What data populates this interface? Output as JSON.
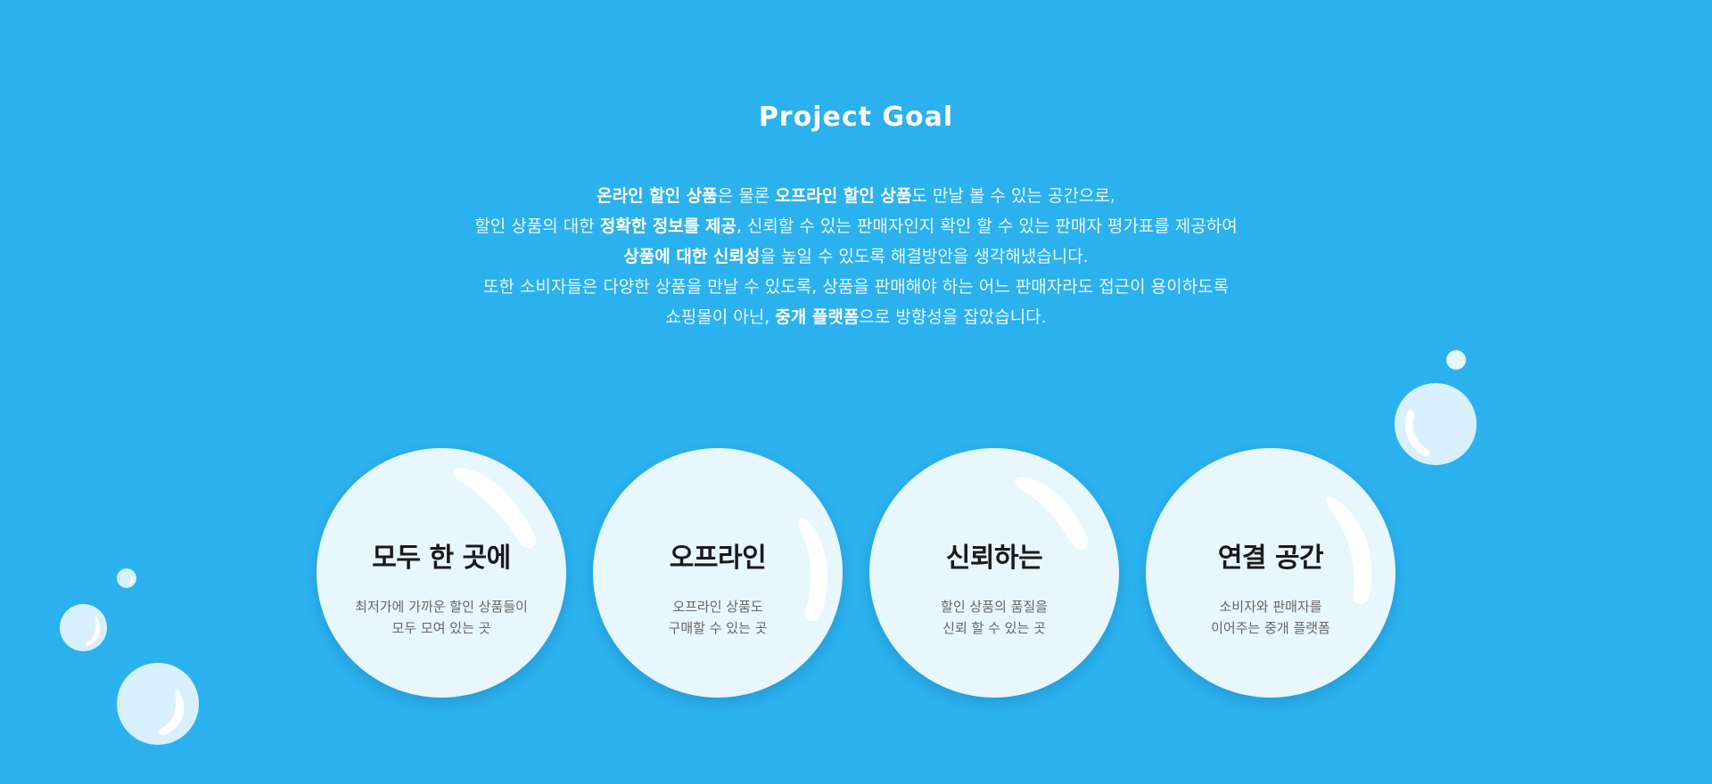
{
  "page": {
    "title": "Project Goal",
    "background_color": "#2bb1ee"
  },
  "description": {
    "line1": {
      "b1": "온라인 할인 상품",
      "t1": "은 물론 ",
      "b2": "오프라인 할인 상품",
      "t2": "도 만날 볼 수 있는 공간으로,"
    },
    "line2": {
      "t1": "할인 상품의 대한 ",
      "b1": "정확한 정보를 제공",
      "t2": ", 신뢰할 수 있는 판매자인지 확인 할 수 있는 판매자 평가표를 제공하여"
    },
    "line3": {
      "b1": "상품에 대한 신뢰성",
      "t1": "을 높일 수 있도록 해결방안을 생각해냈습니다."
    },
    "line4": {
      "t1": "또한 소비자들은 다양한 상품을 만날 수 있도록, 상품을 판매해야 하는 어느 판매자라도 접근이 용이하도록"
    },
    "line5": {
      "t1": "쇼핑몰이 아닌, ",
      "b1": "중개 플랫폼",
      "t2": "으로 방향성을 잡았습니다."
    }
  },
  "goals": [
    {
      "title": "모두 한 곳에",
      "desc_line1": "최저가에 가까운 할인 상품들이",
      "desc_line2": "모두 모여 있는 곳"
    },
    {
      "title": "오프라인",
      "desc_line1": "오프라인 상품도",
      "desc_line2": "구매할 수 있는 곳"
    },
    {
      "title": "신뢰하는",
      "desc_line1": "할인 상품의 품질을",
      "desc_line2": "신뢰 할 수 있는 곳"
    },
    {
      "title": "연결 공간",
      "desc_line1": "소비자와 판매자를",
      "desc_line2": "이어주는 중개 플랫폼"
    }
  ]
}
